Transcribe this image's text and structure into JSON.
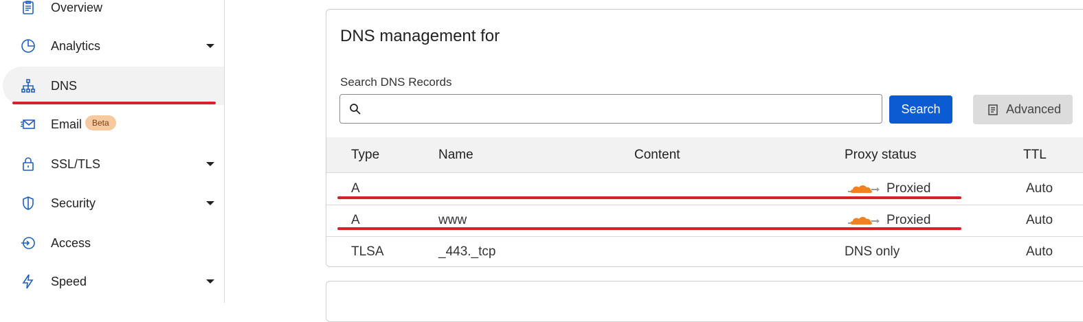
{
  "sidebar": {
    "items": [
      {
        "label": "Overview",
        "icon": "clipboard-icon",
        "caret": false
      },
      {
        "label": "Analytics",
        "icon": "pie-chart-icon",
        "caret": true
      },
      {
        "label": "DNS",
        "icon": "network-icon",
        "caret": false,
        "active": true
      },
      {
        "label": "Email",
        "icon": "envelope-icon",
        "caret": false,
        "badge": "Beta"
      },
      {
        "label": "SSL/TLS",
        "icon": "lock-icon",
        "caret": true
      },
      {
        "label": "Security",
        "icon": "shield-icon",
        "caret": true
      },
      {
        "label": "Access",
        "icon": "access-icon",
        "caret": false
      },
      {
        "label": "Speed",
        "icon": "lightning-icon",
        "caret": true
      }
    ]
  },
  "main": {
    "title": "DNS management for",
    "search": {
      "label": "Search DNS Records",
      "value": "",
      "placeholder": ""
    },
    "search_button": "Search",
    "advanced_button": "Advanced",
    "table": {
      "headers": [
        "Type",
        "Name",
        "Content",
        "Proxy status",
        "TTL"
      ],
      "rows": [
        {
          "type": "A",
          "name": "",
          "content": "",
          "proxy": "Proxied",
          "proxied": true,
          "ttl": "Auto"
        },
        {
          "type": "A",
          "name": "www",
          "content": "",
          "proxy": "Proxied",
          "proxied": true,
          "ttl": "Auto"
        },
        {
          "type": "TLSA",
          "name": "_443._tcp",
          "content": "",
          "proxy": "DNS only",
          "proxied": false,
          "ttl": "Auto"
        }
      ]
    }
  },
  "colors": {
    "accent": "#0b5bd3",
    "annotation": "#d8202a",
    "cloud": "#f48120",
    "badge_bg": "#f6c9a1"
  }
}
